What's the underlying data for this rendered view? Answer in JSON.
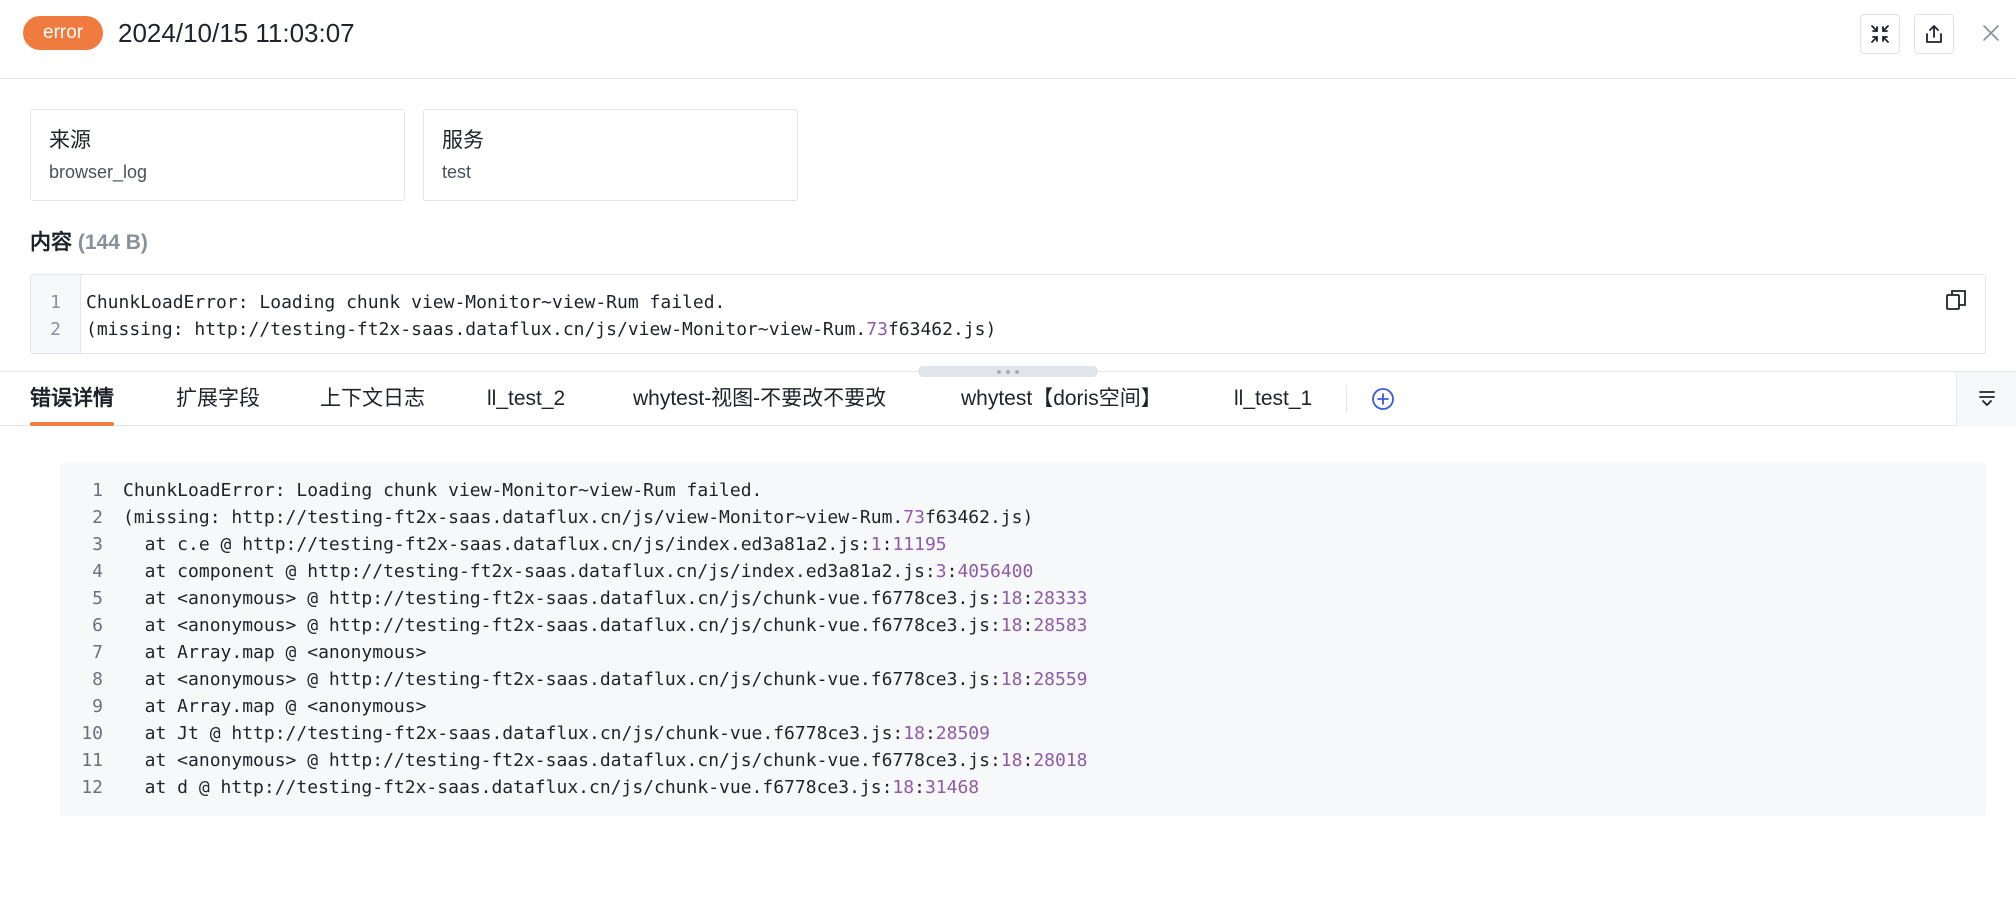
{
  "header": {
    "level": "error",
    "time": "2024/10/15 11:03:07",
    "icons": {
      "fullscreen": "fullscreen-exit-icon",
      "share": "share-icon",
      "close": "close-icon"
    }
  },
  "cards": {
    "source": {
      "label": "来源",
      "value": "browser_log"
    },
    "service": {
      "label": "服务",
      "value": "test"
    }
  },
  "content": {
    "title": "内容",
    "size": "(144 B)",
    "copy_icon": "copy-icon",
    "lines": [
      {
        "n": "1",
        "segments": [
          {
            "t": "ChunkLoadError: Loading chunk view-Monitor~view-Rum failed."
          }
        ]
      },
      {
        "n": "2",
        "segments": [
          {
            "t": "(missing: http://testing-ft2x-saas.dataflux.cn/js/view-Monitor~view-Rum."
          },
          {
            "t": "73",
            "num": true
          },
          {
            "t": "f63462.js)"
          }
        ]
      }
    ]
  },
  "tabs": [
    {
      "label": "错误详情",
      "active": true
    },
    {
      "label": "扩展字段",
      "active": false
    },
    {
      "label": "上下文日志",
      "active": false
    },
    {
      "label": "ll_test_2",
      "active": false
    },
    {
      "label": "whytest-视图-不要改不要改",
      "active": false
    },
    {
      "label": "whytest【doris空间】",
      "active": false
    },
    {
      "label": "ll_test_1",
      "active": false
    }
  ],
  "tab_icons": {
    "add": "add-circle-icon",
    "collapse": "collapse-icon"
  },
  "detail": {
    "lines": [
      {
        "n": "1",
        "segments": [
          {
            "t": "ChunkLoadError: Loading chunk view-Monitor~view-Rum failed."
          }
        ]
      },
      {
        "n": "2",
        "segments": [
          {
            "t": "(missing: http://testing-ft2x-saas.dataflux.cn/js/view-Monitor~view-Rum."
          },
          {
            "t": "73",
            "num": true
          },
          {
            "t": "f63462.js)"
          }
        ]
      },
      {
        "n": "3",
        "segments": [
          {
            "t": "  at c.e @ http://testing-ft2x-saas.dataflux.cn/js/index.ed3a81a2.js:"
          },
          {
            "t": "1",
            "num": true
          },
          {
            "t": ":"
          },
          {
            "t": "11195",
            "num": true
          }
        ]
      },
      {
        "n": "4",
        "segments": [
          {
            "t": "  at component @ http://testing-ft2x-saas.dataflux.cn/js/index.ed3a81a2.js:"
          },
          {
            "t": "3",
            "num": true
          },
          {
            "t": ":"
          },
          {
            "t": "4056400",
            "num": true
          }
        ]
      },
      {
        "n": "5",
        "segments": [
          {
            "t": "  at <anonymous> @ http://testing-ft2x-saas.dataflux.cn/js/chunk-vue.f6778ce3.js:"
          },
          {
            "t": "18",
            "num": true
          },
          {
            "t": ":"
          },
          {
            "t": "28333",
            "num": true
          }
        ]
      },
      {
        "n": "6",
        "segments": [
          {
            "t": "  at <anonymous> @ http://testing-ft2x-saas.dataflux.cn/js/chunk-vue.f6778ce3.js:"
          },
          {
            "t": "18",
            "num": true
          },
          {
            "t": ":"
          },
          {
            "t": "28583",
            "num": true
          }
        ]
      },
      {
        "n": "7",
        "segments": [
          {
            "t": "  at Array.map @ <anonymous>"
          }
        ]
      },
      {
        "n": "8",
        "segments": [
          {
            "t": "  at <anonymous> @ http://testing-ft2x-saas.dataflux.cn/js/chunk-vue.f6778ce3.js:"
          },
          {
            "t": "18",
            "num": true
          },
          {
            "t": ":"
          },
          {
            "t": "28559",
            "num": true
          }
        ]
      },
      {
        "n": "9",
        "segments": [
          {
            "t": "  at Array.map @ <anonymous>"
          }
        ]
      },
      {
        "n": "10",
        "segments": [
          {
            "t": "  at Jt @ http://testing-ft2x-saas.dataflux.cn/js/chunk-vue.f6778ce3.js:"
          },
          {
            "t": "18",
            "num": true
          },
          {
            "t": ":"
          },
          {
            "t": "28509",
            "num": true
          }
        ]
      },
      {
        "n": "11",
        "segments": [
          {
            "t": "  at <anonymous> @ http://testing-ft2x-saas.dataflux.cn/js/chunk-vue.f6778ce3.js:"
          },
          {
            "t": "18",
            "num": true
          },
          {
            "t": ":"
          },
          {
            "t": "28018",
            "num": true
          }
        ]
      },
      {
        "n": "12",
        "segments": [
          {
            "t": "  at d @ http://testing-ft2x-saas.dataflux.cn/js/chunk-vue.f6778ce3.js:"
          },
          {
            "t": "18",
            "num": true
          },
          {
            "t": ":"
          },
          {
            "t": "31468",
            "num": true
          }
        ]
      }
    ]
  }
}
